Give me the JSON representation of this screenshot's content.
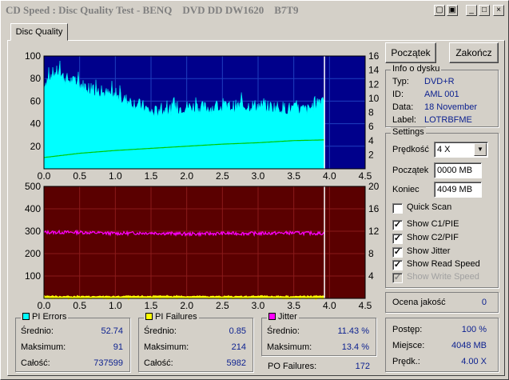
{
  "window": {
    "title": "CD Speed : Disc Quality Test - BENQ    DVD DD DW1620    B7T9",
    "buttons": [
      "▢",
      "▣",
      "_",
      "□",
      "×"
    ]
  },
  "tab": {
    "label": "Disc Quality"
  },
  "actions": {
    "start_label": "Początek",
    "end_label": "Zakończ"
  },
  "disc_info": {
    "title": "Info o dysku",
    "rows": [
      {
        "label": "Typ:",
        "value": "DVD+R"
      },
      {
        "label": "ID:",
        "value": "AML 001"
      },
      {
        "label": "Data:",
        "value": "18 November"
      },
      {
        "label": "Label:",
        "value": "LOTRBFME"
      }
    ]
  },
  "settings": {
    "title": "Settings",
    "speed_label": "Prędkość",
    "speed_value": "4 X",
    "start_label": "Początek",
    "start_value": "0000 MB",
    "end_label": "Koniec",
    "end_value": "4049 MB",
    "checkboxes": [
      {
        "label": "Quick Scan",
        "checked": false,
        "enabled": true
      },
      {
        "label": "Show C1/PIE",
        "checked": true,
        "enabled": true
      },
      {
        "label": "Show C2/PIF",
        "checked": true,
        "enabled": true
      },
      {
        "label": "Show Jitter",
        "checked": true,
        "enabled": true
      },
      {
        "label": "Show Read Speed",
        "checked": true,
        "enabled": true
      },
      {
        "label": "Show Write Speed",
        "checked": true,
        "enabled": false
      }
    ]
  },
  "quality": {
    "label": "Ocena jakość",
    "value": "0"
  },
  "progress": {
    "rows": [
      {
        "label": "Postęp:",
        "value": "100 %"
      },
      {
        "label": "Miejsce:",
        "value": "4048 MB"
      },
      {
        "label": "Prędk.:",
        "value": "4.00 X"
      }
    ]
  },
  "pi_errors": {
    "title": "PI Errors",
    "color": "#00ffff",
    "rows": [
      {
        "label": "Średnio:",
        "value": "52.74"
      },
      {
        "label": "Maksimum:",
        "value": "91"
      },
      {
        "label": "Całość:",
        "value": "737599"
      }
    ]
  },
  "pi_failures": {
    "title": "PI Failures",
    "color": "#ffff00",
    "rows": [
      {
        "label": "Średnio:",
        "value": "0.85"
      },
      {
        "label": "Maksimum:",
        "value": "214"
      },
      {
        "label": "Całość:",
        "value": "5982"
      }
    ]
  },
  "jitter": {
    "title": "Jitter",
    "color": "#ff00ff",
    "rows": [
      {
        "label": "Średnio:",
        "value": "11.43 %"
      },
      {
        "label": "Maksimum:",
        "value": "13.4 %"
      }
    ]
  },
  "po_failures": {
    "label": "PO Failures:",
    "value": "172"
  },
  "chart_data": [
    {
      "type": "area",
      "xlim": [
        0,
        4.5
      ],
      "ylim": [
        0,
        100
      ],
      "y2lim": [
        0,
        16
      ],
      "x_ticks": [
        "0.0",
        "0.5",
        "1.0",
        "1.5",
        "2.0",
        "2.5",
        "3.0",
        "3.5",
        "4.0",
        "4.5"
      ],
      "y_ticks": [
        "100",
        "80",
        "60",
        "40",
        "20"
      ],
      "y2_ticks": [
        "16",
        "14",
        "12",
        "10",
        "8",
        "6",
        "4",
        "2"
      ],
      "grid": true,
      "series": [
        {
          "name": "PI Errors",
          "color": "#00ffff",
          "x": [
            0.0,
            0.1,
            0.2,
            0.3,
            0.5,
            0.7,
            1.0,
            1.2,
            1.4,
            1.5,
            1.7,
            2.0,
            2.3,
            2.6,
            2.9,
            3.2,
            3.5,
            3.7,
            3.8,
            3.93
          ],
          "values": [
            75,
            84,
            86,
            80,
            75,
            70,
            64,
            60,
            55,
            50,
            52,
            55,
            54,
            55,
            56,
            55,
            53,
            52,
            58,
            64
          ]
        },
        {
          "name": "Read Speed",
          "color": "#00c800",
          "axis": "right",
          "x": [
            0.0,
            0.5,
            1.0,
            1.5,
            2.0,
            2.5,
            3.0,
            3.5,
            3.93
          ],
          "values": [
            1.6,
            2.2,
            2.6,
            2.9,
            3.2,
            3.5,
            3.7,
            4.0,
            4.1
          ]
        }
      ],
      "end_marker": 3.93
    },
    {
      "type": "line",
      "xlim": [
        0,
        4.5
      ],
      "ylim": [
        0,
        500
      ],
      "y2lim": [
        0,
        20
      ],
      "x_ticks": [
        "0.0",
        "0.5",
        "1.0",
        "1.5",
        "2.0",
        "2.5",
        "3.0",
        "3.5",
        "4.0",
        "4.5"
      ],
      "y_ticks": [
        "500",
        "400",
        "300",
        "200",
        "100"
      ],
      "y2_ticks": [
        "20",
        "16",
        "12",
        "8",
        "4"
      ],
      "grid": true,
      "series": [
        {
          "name": "Jitter",
          "color": "#ff00ff",
          "axis": "right",
          "x": [
            0.0,
            0.5,
            1.0,
            1.5,
            2.0,
            2.5,
            3.0,
            3.5,
            3.93
          ],
          "values": [
            11.8,
            11.8,
            11.6,
            11.7,
            11.5,
            11.6,
            11.6,
            11.7,
            11.6
          ]
        },
        {
          "name": "PI Failures",
          "color": "#ffff00",
          "x": [
            0.0,
            0.5,
            1.0,
            1.5,
            2.0,
            2.5,
            3.0,
            3.5,
            3.93
          ],
          "values": [
            5,
            4,
            4,
            5,
            5,
            4,
            5,
            4,
            5
          ]
        }
      ],
      "end_marker": 3.93
    }
  ]
}
